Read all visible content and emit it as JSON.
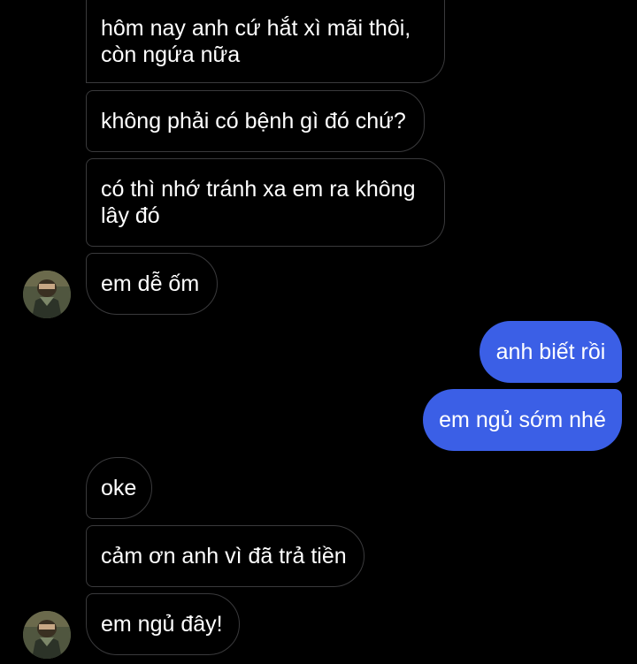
{
  "messages": [
    {
      "sender": "them",
      "text": "hôm nay anh cứ hắt xì mãi thôi,\ncòn ngứa nữa"
    },
    {
      "sender": "them",
      "text": "không phải có bệnh gì đó chứ?"
    },
    {
      "sender": "them",
      "text": "có thì nhớ tránh xa em ra không\nlây đó"
    },
    {
      "sender": "them",
      "text": "em dễ ốm"
    },
    {
      "sender": "me",
      "text": "anh biết rồi"
    },
    {
      "sender": "me",
      "text": "em ngủ sớm nhé"
    },
    {
      "sender": "them",
      "text": "oke"
    },
    {
      "sender": "them",
      "text": "cảm ơn anh vì đã trả tiền"
    },
    {
      "sender": "them",
      "text": "em ngủ đây!"
    }
  ],
  "colors": {
    "background": "#000000",
    "incoming_border": "#3a3a3c",
    "outgoing_bubble": "#3b5fe6",
    "text": "#ffffff"
  },
  "icons": {
    "avatar": "contact-avatar-photo"
  }
}
